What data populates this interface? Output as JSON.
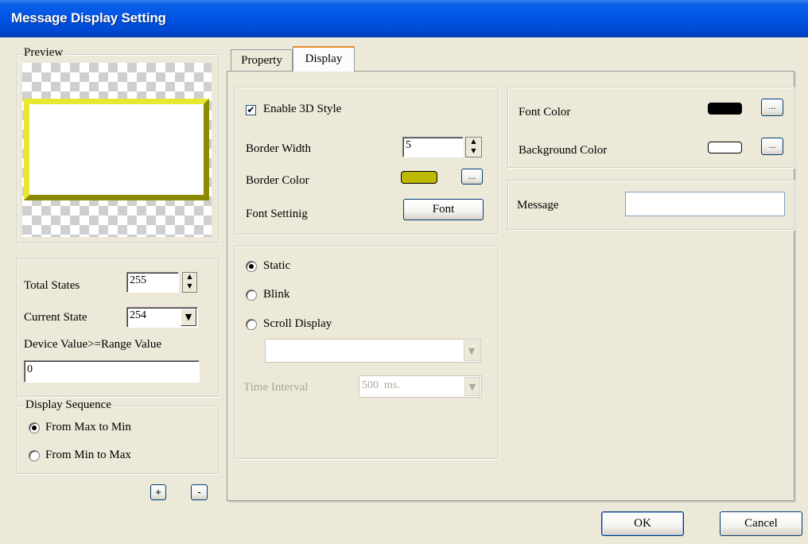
{
  "window": {
    "title": "Message Display Setting"
  },
  "preview": {
    "legend": "Preview",
    "border_color": "#C8C800"
  },
  "states": {
    "total_states_label": "Total States",
    "total_states_value": "255",
    "current_state_label": "Current State",
    "current_state_value": "254",
    "range_label": "Device Value>=Range Value",
    "range_value": "0"
  },
  "display_sequence": {
    "legend": "Display Sequence",
    "options": [
      "From Max to Min",
      "From Min to Max"
    ],
    "selected": "From Max to Min"
  },
  "state_buttons": {
    "add": "+",
    "remove": "-"
  },
  "tabs": [
    {
      "label": "Property",
      "active": false
    },
    {
      "label": "Display",
      "active": true
    }
  ],
  "style_panel": {
    "enable_3d_label": "Enable 3D Style",
    "enable_3d_checked": true,
    "border_width_label": "Border Width",
    "border_width_value": "5",
    "border_color_label": "Border Color",
    "border_color_swatch": "#BDB800",
    "font_setting_label": "Font Settinig",
    "font_button": "Font",
    "browse_button": "..."
  },
  "mode_panel": {
    "options": [
      "Static",
      "Blink",
      "Scroll Display"
    ],
    "selected": "Static",
    "scroll_combo_value": "",
    "time_interval_label": "Time Interval",
    "time_interval_value": "500  ms."
  },
  "color_panel": {
    "font_color_label": "Font Color",
    "font_color_swatch": "#000000",
    "background_color_label": "Background Color",
    "background_color_swatch": "#FFFFFF",
    "browse_button": "..."
  },
  "message_panel": {
    "message_label": "Message",
    "message_value": ""
  },
  "footer": {
    "ok": "OK",
    "cancel": "Cancel"
  }
}
